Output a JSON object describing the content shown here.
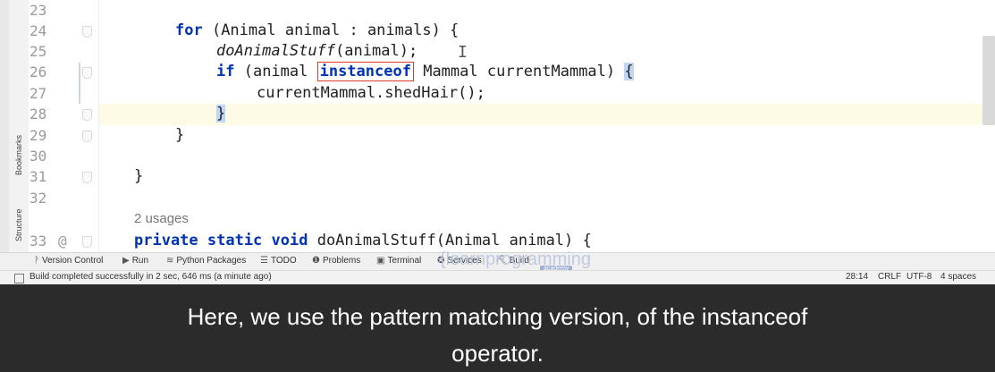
{
  "editor": {
    "line_numbers": [
      "23",
      "24",
      "25",
      "26",
      "27",
      "28",
      "29",
      "30",
      "31",
      "32",
      "33"
    ],
    "line33_marker": "@",
    "lines": {
      "l24_kw": "for",
      "l24_rest": " (Animal animal : animals) {",
      "l25_call": "doAnimalStuff",
      "l25_rest": "(animal);",
      "l26_kw": "if",
      "l26_pre": " (animal ",
      "l26_boxed": "instanceof",
      "l26_post": " Mammal currentMammal) ",
      "l26_brace": "{",
      "l27": "currentMammal.shedHair();",
      "l28_brace": "}",
      "l29": "}",
      "l31": "}",
      "usages": "2 usages",
      "l33_kw": "private static void",
      "l33_rest": " doAnimalStuff(Animal animal) {"
    },
    "cursor_glyph": "I"
  },
  "side_tabs": {
    "bookmarks": "Bookmarks",
    "structure": "Structure"
  },
  "tool_windows": [
    {
      "icon": "ᚹ",
      "label": "Version Control"
    },
    {
      "icon": "▶",
      "label": "Run"
    },
    {
      "icon": "≋",
      "label": "Python Packages"
    },
    {
      "icon": "☰",
      "label": "TODO"
    },
    {
      "icon": "❶",
      "label": "Problems"
    },
    {
      "icon": "▣",
      "label": "Terminal"
    },
    {
      "icon": "✪",
      "label": "Services"
    },
    {
      "icon": "⛏",
      "label": "Build"
    }
  ],
  "watermark": {
    "text": "{learnprogramming",
    "badge": "academy"
  },
  "status": {
    "message": "Build completed successfully in 2 sec, 646 ms (a minute ago)",
    "position": "28:14",
    "line_sep": "CRLF",
    "encoding": "UTF-8",
    "indent": "4 spaces"
  },
  "caption": {
    "line1": "Here, we use the pattern matching version, of the instanceof",
    "line2": "operator."
  }
}
